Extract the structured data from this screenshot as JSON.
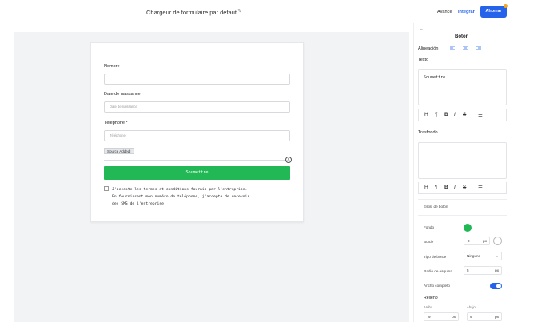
{
  "header": {
    "title": "Chargeur de formulaire par défaut",
    "advance_label": "Avance",
    "integrate_label": "Integrar",
    "save_label": "Ahorrar"
  },
  "form": {
    "name_label": "Nombre",
    "name_value": "",
    "birthdate_label": "Date de naissance",
    "birthdate_placeholder": "Date de naissance",
    "phone_label": "Téléphone *",
    "phone_placeholder": "Téléphone",
    "source_badge": "Source Added!",
    "submit_label": "Soumettre",
    "terms_text": "J'accepte les termes et conditions fournis par l'entreprise.\nEn fournissant mon numéro de téléphone, j'accepte de recevoir\ndes SMS de l'entreprise."
  },
  "panel": {
    "header": "Botón",
    "alignment_label": "Alineación",
    "text_label": "Texto",
    "text_value": "Soumettre",
    "background_label": "Trasfondo",
    "button_style_label": "Estilo de botón",
    "fondo_label": "Fondo",
    "fondo_color": "#22b856",
    "border_label": "Borde",
    "border_value": "0",
    "border_unit": "px",
    "border_type_label": "Tipo de borde",
    "border_type_value": "Ninguno",
    "radius_label": "Radio de esquina",
    "radius_value": "5",
    "radius_unit": "px",
    "fullwidth_label": "Ancho completo",
    "fullwidth_on": true,
    "padding_label": "Relleno",
    "top_label": "Arriba",
    "top_value": "9",
    "bottom_label": "Abajo",
    "bottom_value": "9",
    "padding_unit": "px",
    "toolbar_glyphs": [
      "H",
      "¶",
      "B",
      "I",
      "S",
      "☰"
    ]
  },
  "colors": {
    "accent": "#2563eb",
    "submit_green": "#22b856",
    "notify_dot": "#f5a623"
  }
}
